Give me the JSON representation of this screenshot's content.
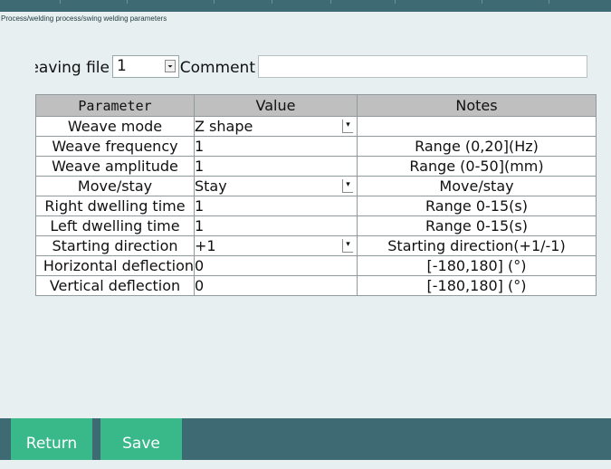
{
  "breadcrumb": "Process/welding process/swing welding parameters",
  "header": {
    "file_label": "Weaving file",
    "file_value": "1",
    "comment_label": "Comment",
    "comment_value": ""
  },
  "table": {
    "headers": {
      "parameter": "Parameter",
      "value": "Value",
      "notes": "Notes"
    },
    "rows": [
      {
        "parameter": "Weave mode",
        "value": "Z shape",
        "notes": "",
        "dropdown": true
      },
      {
        "parameter": "Weave frequency",
        "value": "1",
        "notes": "Range (0,20](Hz)",
        "dropdown": false
      },
      {
        "parameter": "Weave amplitude",
        "value": "1",
        "notes": "Range (0-50](mm)",
        "dropdown": false
      },
      {
        "parameter": "Move/stay",
        "value": "Stay",
        "notes": "Move/stay",
        "dropdown": true
      },
      {
        "parameter": "Right dwelling time",
        "value": "1",
        "notes": "Range 0-15(s)",
        "dropdown": false
      },
      {
        "parameter": "Left dwelling time",
        "value": "1",
        "notes": "Range 0-15(s)",
        "dropdown": false
      },
      {
        "parameter": "Starting direction",
        "value": "+1",
        "notes": "Starting direction(+1/-1)",
        "dropdown": true
      },
      {
        "parameter": "Horizontal deflection",
        "value": "0",
        "notes": "[-180,180]  (°)",
        "dropdown": false
      },
      {
        "parameter": "Vertical deflection",
        "value": "0",
        "notes": "[-180,180]  (°)",
        "dropdown": false
      }
    ]
  },
  "footer": {
    "return_label": "Return",
    "save_label": "Save"
  },
  "colors": {
    "topbar": "#3d6a73",
    "button": "#39b88a",
    "background": "#e7eff0",
    "header_cell": "#bfbfbf"
  }
}
